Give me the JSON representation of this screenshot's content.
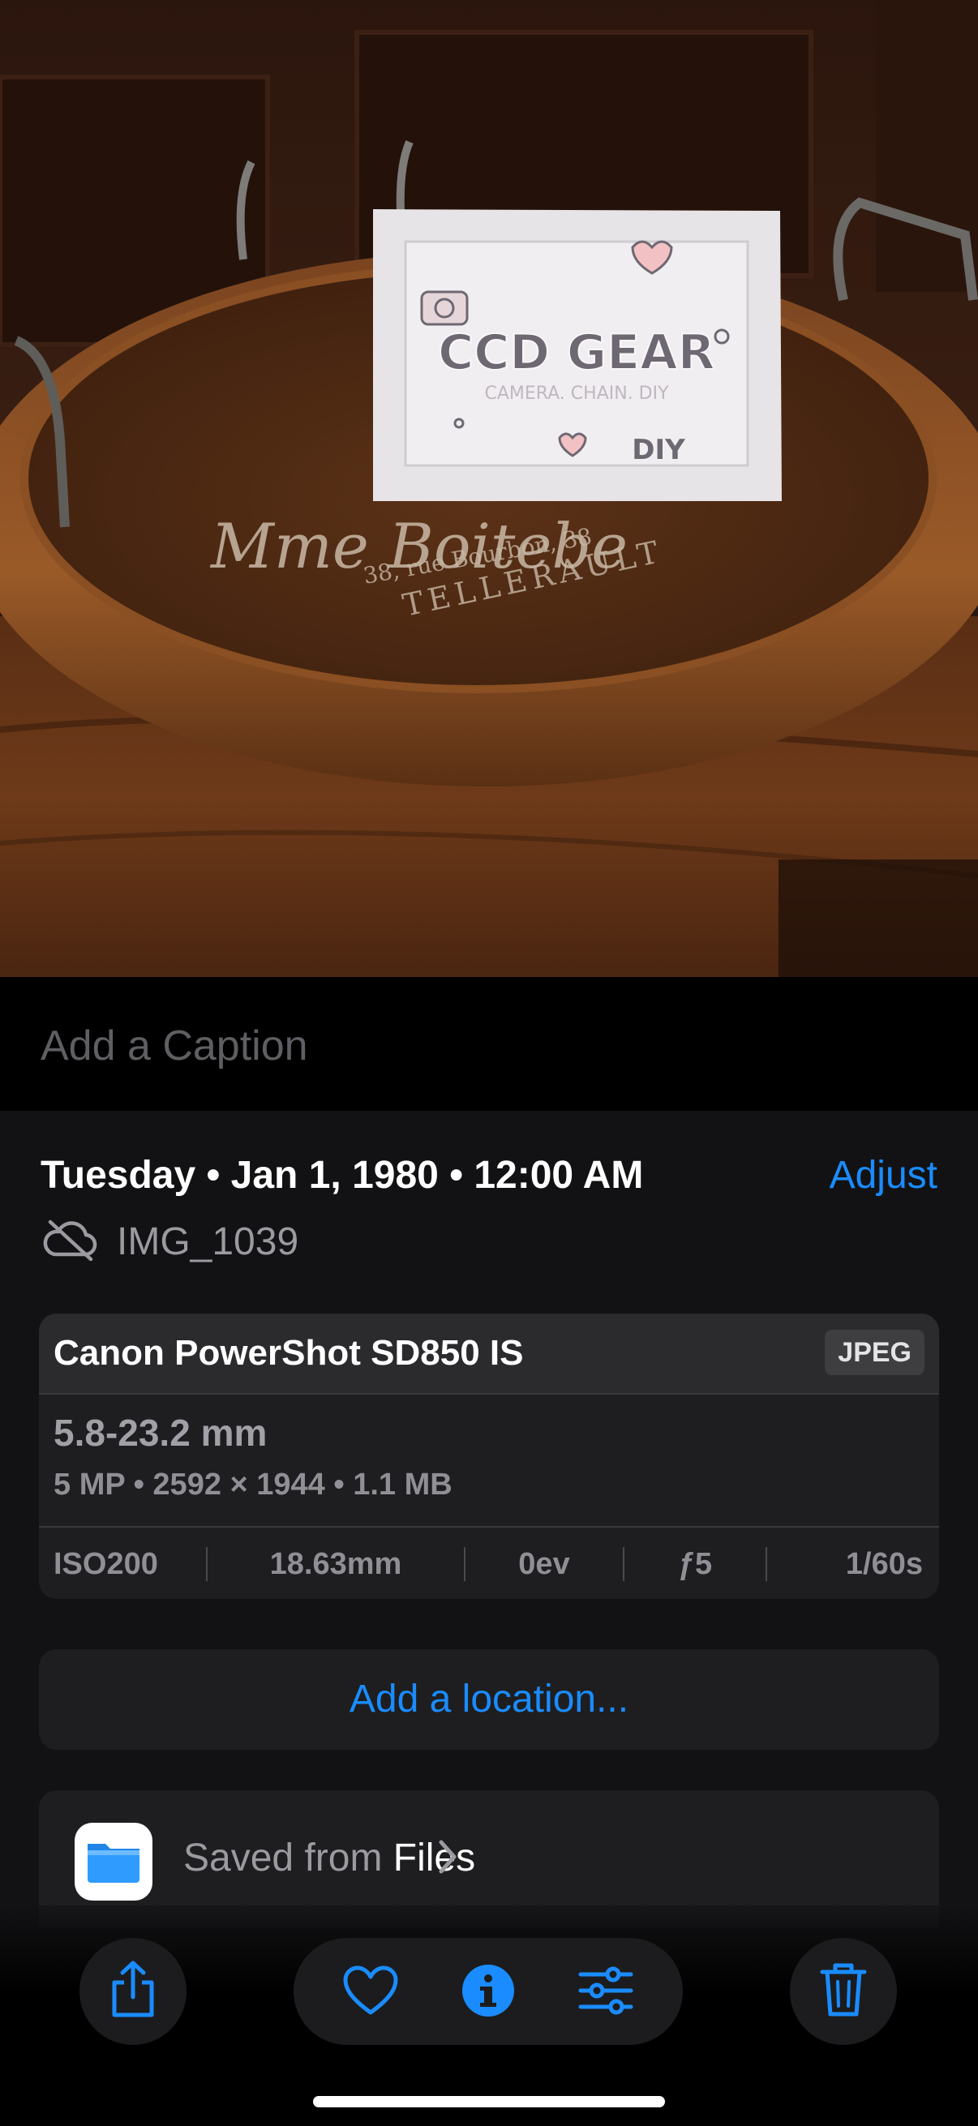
{
  "photo": {
    "frame_title": "CCD GEAR",
    "frame_subtitle": "CAMERA. CHAIN. DIY",
    "frame_badge": "DIY",
    "tray_line1": "Mme Boitebe",
    "tray_line2": "38, rue Bourbon, 38",
    "tray_line3": "TELLERAULT"
  },
  "caption": {
    "placeholder": "Add a Caption"
  },
  "info": {
    "date": "Tuesday • Jan 1, 1980 • 12:00 AM",
    "adjust_label": "Adjust",
    "filename": "IMG_1039",
    "cloud_status_icon": "icloud-slash-icon"
  },
  "exif": {
    "camera": "Canon PowerShot SD850 IS",
    "format": "JPEG",
    "lens": "5.8-23.2 mm",
    "specs": "5 MP  •  2592 × 1944  •  1.1 MB",
    "iso": "ISO200",
    "focal": "18.63mm",
    "ev": "0ev",
    "aperture": "ƒ5",
    "shutter": "1/60s"
  },
  "location": {
    "label": "Add a location..."
  },
  "source": {
    "prefix": "Saved from ",
    "app": "Files",
    "app_icon": "files-folder-icon"
  },
  "toolbar": {
    "icons": [
      "share-icon",
      "heart-icon",
      "info-icon",
      "adjust-sliders-icon",
      "trash-icon"
    ],
    "accent": "#1a8cff"
  }
}
